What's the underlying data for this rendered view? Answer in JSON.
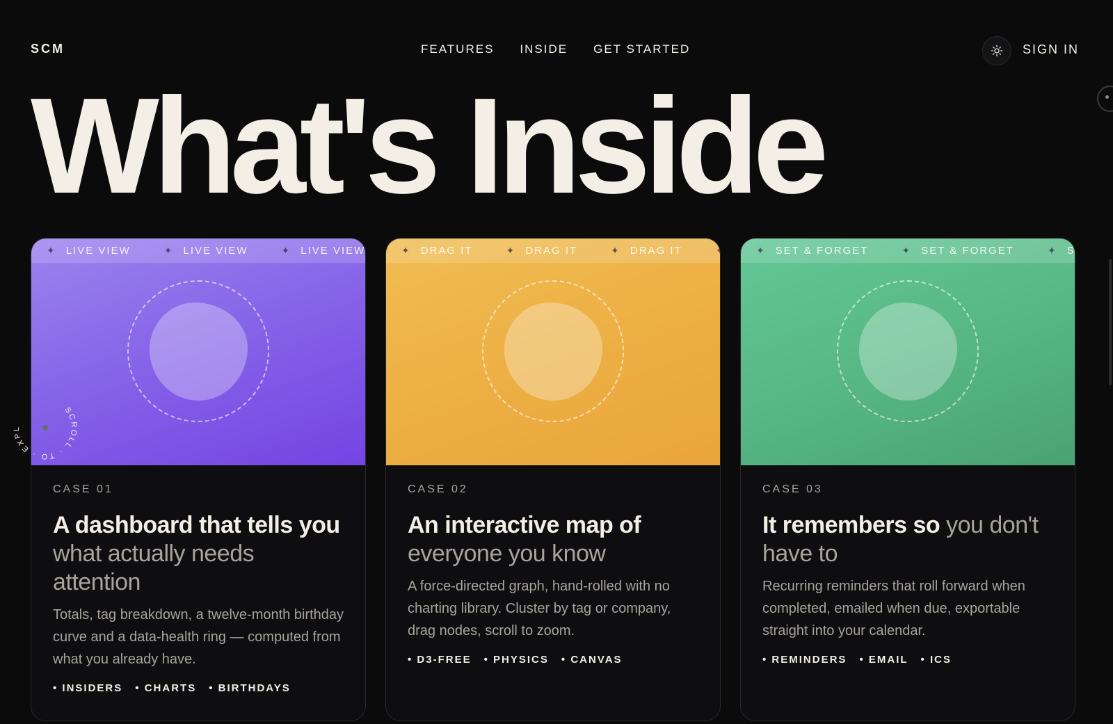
{
  "nav": {
    "brand": "SCM",
    "links": [
      "FEATURES",
      "INSIDE",
      "GET STARTED"
    ],
    "theme_toggle_icon": "sun-icon",
    "sign_in": "SIGN IN"
  },
  "hero": {
    "title": "What's Inside"
  },
  "scroll_badge": {
    "text": "SCROLL · TO · EXPLORE ·"
  },
  "cards": [
    {
      "marquee": "LIVE VIEW",
      "case": "CASE 01",
      "title_strong": "A dashboard that tells you",
      "title_soft": "what actually needs attention",
      "description": "Totals, tag breakdown, a twelve-month birthday curve and a data-health ring — computed from what you already have.",
      "tags": [
        "INSIDERS",
        "CHARTS",
        "BIRTHDAYS"
      ],
      "accent": "#8562e8"
    },
    {
      "marquee": "DRAG IT",
      "case": "CASE 02",
      "title_strong": "An interactive map of",
      "title_soft": "everyone you know",
      "description": "A force-directed graph, hand-rolled with no charting library. Cluster by tag or company, drag nodes, scroll to zoom.",
      "tags": [
        "D3-FREE",
        "PHYSICS",
        "CANVAS"
      ],
      "accent": "#edb045"
    },
    {
      "marquee": "SET & FORGET",
      "case": "CASE 03",
      "title_strong": "It remembers so",
      "title_soft": "you don't have to",
      "description": "Recurring reminders that roll forward when completed, emailed when due, exportable straight into your calendar.",
      "tags": [
        "REMINDERS",
        "EMAIL",
        "ICS"
      ],
      "accent": "#58b885"
    }
  ]
}
